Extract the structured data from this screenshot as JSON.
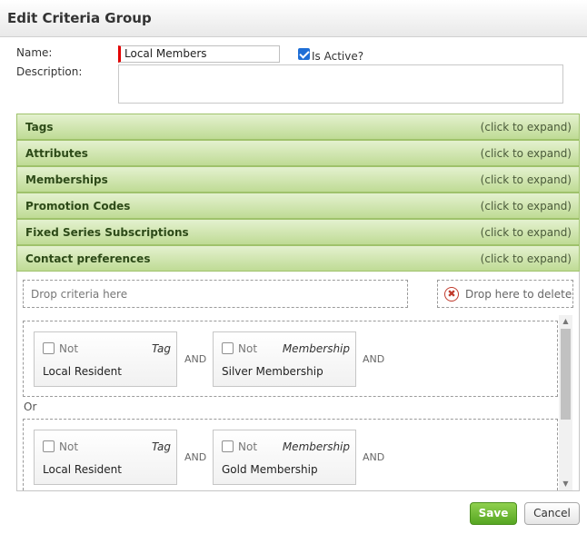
{
  "dialog": {
    "title": "Edit Criteria Group"
  },
  "form": {
    "name_label": "Name:",
    "name_value": "Local Members",
    "is_active_label": "Is Active?",
    "is_active_checked": true,
    "description_label": "Description:",
    "description_value": ""
  },
  "accordion": {
    "sections": [
      {
        "title": "Tags",
        "hint": "(click to expand)"
      },
      {
        "title": "Attributes",
        "hint": "(click to expand)"
      },
      {
        "title": "Memberships",
        "hint": "(click to expand)"
      },
      {
        "title": "Promotion Codes",
        "hint": "(click to expand)"
      },
      {
        "title": "Fixed Series Subscriptions",
        "hint": "(click to expand)"
      },
      {
        "title": "Contact preferences",
        "hint": "(click to expand)"
      }
    ]
  },
  "zones": {
    "drop": "Drop criteria here",
    "delete": "Drop here to delete",
    "delete_icon": "✖"
  },
  "groups": [
    {
      "criteria": [
        {
          "not_label": "Not",
          "type": "Tag",
          "name": "Local Resident"
        },
        {
          "not_label": "Not",
          "type": "Membership",
          "name": "Silver Membership"
        }
      ],
      "connectors": [
        "AND",
        "AND"
      ]
    },
    {
      "criteria": [
        {
          "not_label": "Not",
          "type": "Tag",
          "name": "Local Resident"
        },
        {
          "not_label": "Not",
          "type": "Membership",
          "name": "Gold Membership"
        }
      ],
      "connectors": [
        "AND",
        "AND"
      ]
    }
  ],
  "or_label": "Or",
  "scroll": {
    "up": "▲",
    "down": "▼"
  },
  "buttons": {
    "save": "Save",
    "cancel": "Cancel"
  },
  "colors": {
    "accordion": "#c9e3a4",
    "save": "#6cbb34",
    "required": "#e30000"
  }
}
